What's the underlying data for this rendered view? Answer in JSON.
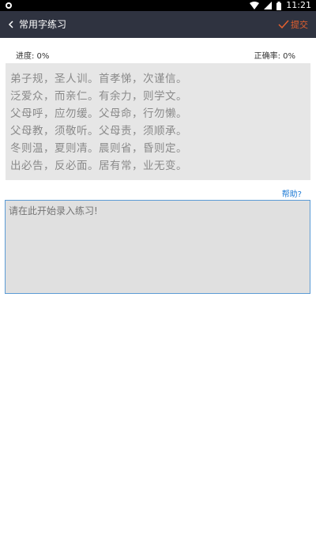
{
  "status_bar": {
    "time": "11:21",
    "icons": [
      "notification-icon",
      "wifi-icon",
      "signal-icon",
      "battery-icon"
    ]
  },
  "header": {
    "title": "常用字练习",
    "submit_label": "提交",
    "accent_color": "#e5602f"
  },
  "stats": {
    "progress_label": "进度: 0%",
    "accuracy_label": "正确率: 0%"
  },
  "passage": {
    "lines": [
      "弟子规，圣人训。首孝悌，次谨信。",
      "泛爱众，而亲仁。有余力，则学文。",
      "父母呼，应勿缓。父母命，行勿懒。",
      "父母教，须敬听。父母责，须顺承。",
      "冬则温，夏则凊。晨则省，昏则定。",
      "出必告，反必面。居有常，业无变。"
    ]
  },
  "help_label": "帮助?",
  "input": {
    "placeholder": "请在此开始录入练习!",
    "value": ""
  }
}
